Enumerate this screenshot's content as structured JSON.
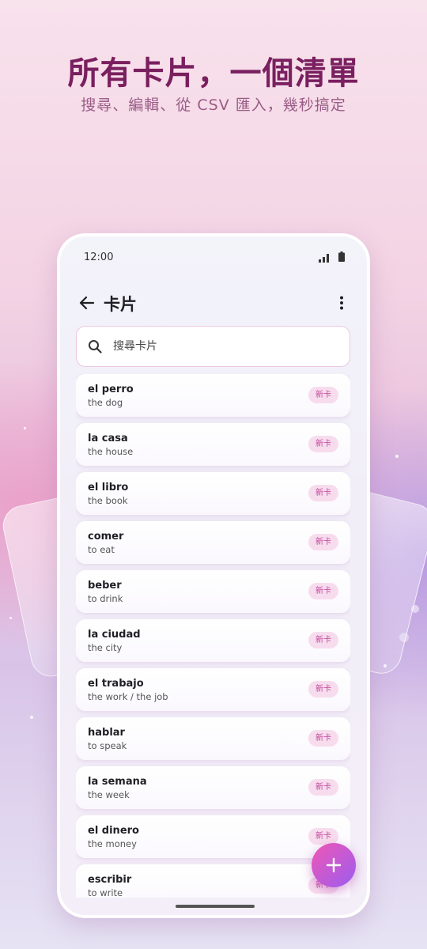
{
  "promo": {
    "headline": "所有卡片，一個清單",
    "subline": "搜尋、編輯、從 CSV 匯入，幾秒搞定"
  },
  "status_bar": {
    "time": "12:00",
    "icons": [
      "signal-icon",
      "battery-icon"
    ]
  },
  "app_bar": {
    "title": "卡片",
    "back_icon": "arrow-left-icon",
    "menu_icon": "more-vert-icon"
  },
  "search": {
    "placeholder": "搜尋卡片",
    "value": "",
    "icon": "search-icon"
  },
  "cards": [
    {
      "term": "el perro",
      "definition": "the dog",
      "badge": "新卡"
    },
    {
      "term": "la casa",
      "definition": "the house",
      "badge": "新卡"
    },
    {
      "term": "el libro",
      "definition": "the book",
      "badge": "新卡"
    },
    {
      "term": "comer",
      "definition": "to eat",
      "badge": "新卡"
    },
    {
      "term": "beber",
      "definition": "to drink",
      "badge": "新卡"
    },
    {
      "term": "la ciudad",
      "definition": "the city",
      "badge": "新卡"
    },
    {
      "term": "el trabajo",
      "definition": "the work / the job",
      "badge": "新卡"
    },
    {
      "term": "hablar",
      "definition": "to speak",
      "badge": "新卡"
    },
    {
      "term": "la semana",
      "definition": "the week",
      "badge": "新卡"
    },
    {
      "term": "el dinero",
      "definition": "the money",
      "badge": "新卡"
    },
    {
      "term": "escribir",
      "definition": "to write",
      "badge": "新卡"
    }
  ],
  "fab": {
    "icon": "plus-icon"
  },
  "colors": {
    "headline": "#7a1f5f",
    "badge_bg": "#f7dcee",
    "badge_text": "#c0489a",
    "fab_gradient_start": "#f057b5",
    "fab_gradient_end": "#9b5cf0"
  }
}
